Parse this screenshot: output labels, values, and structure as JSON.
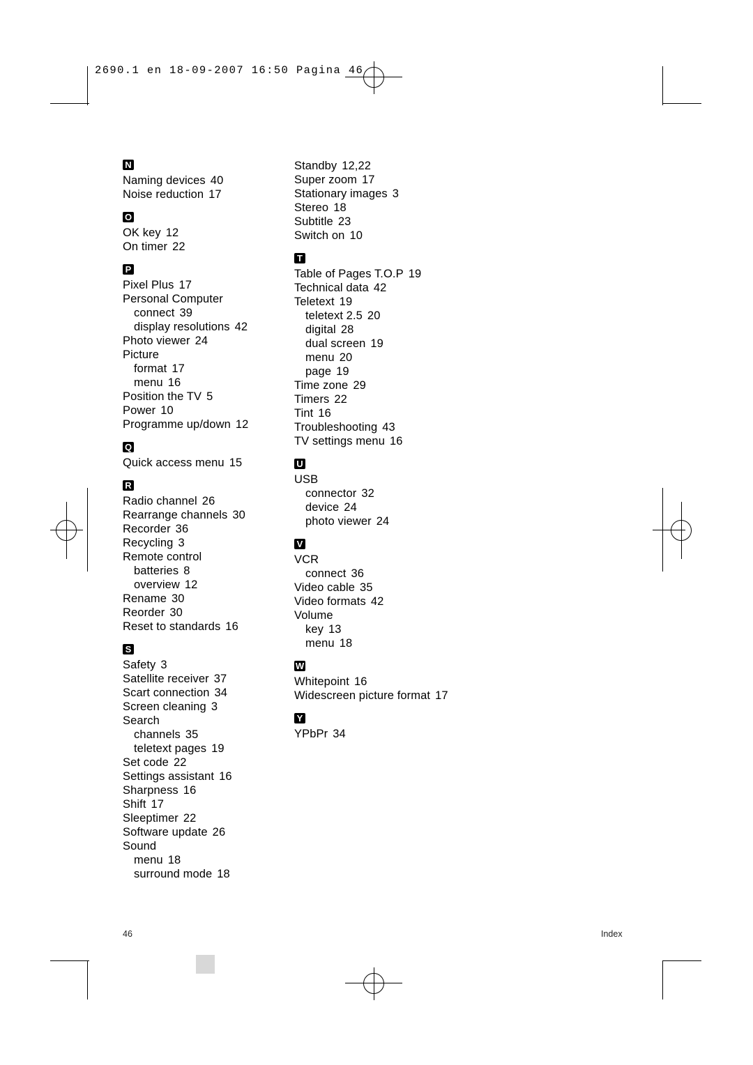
{
  "header": {
    "imprint": "2690.1 en  18-09-2007  16:50  Pagina 46"
  },
  "footer": {
    "page_number": "46",
    "section_label": "Index"
  },
  "index": {
    "left_column": [
      {
        "type": "letter",
        "label": "N"
      },
      {
        "type": "entry",
        "text": "Naming devices",
        "page": "40"
      },
      {
        "type": "entry",
        "text": "Noise reduction",
        "page": "17"
      },
      {
        "type": "letter",
        "label": "O"
      },
      {
        "type": "entry",
        "text": "OK key",
        "page": "12"
      },
      {
        "type": "entry",
        "text": "On timer",
        "page": "22"
      },
      {
        "type": "letter",
        "label": "P"
      },
      {
        "type": "entry",
        "text": "Pixel Plus",
        "page": "17"
      },
      {
        "type": "entry",
        "text": "Personal Computer",
        "page": ""
      },
      {
        "type": "sub",
        "text": "connect",
        "page": "39"
      },
      {
        "type": "sub",
        "text": "display resolutions",
        "page": "42"
      },
      {
        "type": "entry",
        "text": "Photo viewer",
        "page": "24"
      },
      {
        "type": "entry",
        "text": "Picture",
        "page": ""
      },
      {
        "type": "sub",
        "text": "format",
        "page": "17"
      },
      {
        "type": "sub",
        "text": "menu",
        "page": "16"
      },
      {
        "type": "entry",
        "text": "Position the TV",
        "page": "5"
      },
      {
        "type": "entry",
        "text": "Power",
        "page": "10"
      },
      {
        "type": "entry",
        "text": "Programme up/down",
        "page": "12"
      },
      {
        "type": "letter",
        "label": "Q"
      },
      {
        "type": "entry",
        "text": "Quick access menu",
        "page": "15"
      },
      {
        "type": "letter",
        "label": "R"
      },
      {
        "type": "entry",
        "text": "Radio channel",
        "page": "26"
      },
      {
        "type": "entry",
        "text": "Rearrange channels",
        "page": "30"
      },
      {
        "type": "entry",
        "text": "Recorder",
        "page": "36"
      },
      {
        "type": "entry",
        "text": "Recycling",
        "page": "3"
      },
      {
        "type": "entry",
        "text": "Remote control",
        "page": ""
      },
      {
        "type": "sub",
        "text": "batteries",
        "page": "8"
      },
      {
        "type": "sub",
        "text": "overview",
        "page": "12"
      },
      {
        "type": "entry",
        "text": "Rename",
        "page": "30"
      },
      {
        "type": "entry",
        "text": "Reorder",
        "page": "30"
      },
      {
        "type": "entry",
        "text": "Reset to standards",
        "page": "16"
      },
      {
        "type": "letter",
        "label": "S"
      },
      {
        "type": "entry",
        "text": "Safety",
        "page": "3"
      },
      {
        "type": "entry",
        "text": "Satellite receiver",
        "page": "37"
      },
      {
        "type": "entry",
        "text": "Scart connection",
        "page": "34"
      },
      {
        "type": "entry",
        "text": "Screen cleaning",
        "page": "3"
      },
      {
        "type": "entry",
        "text": "Search",
        "page": ""
      },
      {
        "type": "sub",
        "text": "channels",
        "page": "35"
      },
      {
        "type": "sub",
        "text": "teletext pages",
        "page": "19"
      },
      {
        "type": "entry",
        "text": "Set code",
        "page": "22"
      },
      {
        "type": "entry",
        "text": "Settings assistant",
        "page": "16"
      },
      {
        "type": "entry",
        "text": "Sharpness",
        "page": "16"
      },
      {
        "type": "entry",
        "text": "Shift",
        "page": "17"
      },
      {
        "type": "entry",
        "text": "Sleeptimer",
        "page": "22"
      },
      {
        "type": "entry",
        "text": "Software update",
        "page": "26"
      },
      {
        "type": "entry",
        "text": "Sound",
        "page": ""
      },
      {
        "type": "sub",
        "text": "menu",
        "page": "18"
      },
      {
        "type": "sub",
        "text": "surround mode",
        "page": "18"
      }
    ],
    "right_column": [
      {
        "type": "entry",
        "text": "Standby",
        "page": "12,22"
      },
      {
        "type": "entry",
        "text": "Super zoom",
        "page": "17"
      },
      {
        "type": "entry",
        "text": "Stationary images",
        "page": "3"
      },
      {
        "type": "entry",
        "text": "Stereo",
        "page": "18"
      },
      {
        "type": "entry",
        "text": "Subtitle",
        "page": "23"
      },
      {
        "type": "entry",
        "text": "Switch on",
        "page": "10"
      },
      {
        "type": "letter",
        "label": "T"
      },
      {
        "type": "entry",
        "text": "Table of Pages T.O.P",
        "page": "19"
      },
      {
        "type": "entry",
        "text": "Technical data",
        "page": "42"
      },
      {
        "type": "entry",
        "text": "Teletext",
        "page": "19"
      },
      {
        "type": "sub",
        "text": "teletext 2.5",
        "page": "20"
      },
      {
        "type": "sub",
        "text": "digital",
        "page": "28"
      },
      {
        "type": "sub",
        "text": "dual screen",
        "page": "19"
      },
      {
        "type": "sub",
        "text": "menu",
        "page": "20"
      },
      {
        "type": "sub",
        "text": "page",
        "page": "19"
      },
      {
        "type": "entry",
        "text": "Time zone",
        "page": "29"
      },
      {
        "type": "entry",
        "text": "Timers",
        "page": "22"
      },
      {
        "type": "entry",
        "text": "Tint",
        "page": "16"
      },
      {
        "type": "entry",
        "text": "Troubleshooting",
        "page": "43"
      },
      {
        "type": "entry",
        "text": "TV settings menu",
        "page": "16"
      },
      {
        "type": "letter",
        "label": "U"
      },
      {
        "type": "entry",
        "text": "USB",
        "page": ""
      },
      {
        "type": "sub",
        "text": "connector",
        "page": "32"
      },
      {
        "type": "sub",
        "text": "device",
        "page": "24"
      },
      {
        "type": "sub",
        "text": "photo viewer",
        "page": "24"
      },
      {
        "type": "letter",
        "label": "V"
      },
      {
        "type": "entry",
        "text": "VCR",
        "page": ""
      },
      {
        "type": "sub",
        "text": "connect",
        "page": "36"
      },
      {
        "type": "entry",
        "text": "Video cable",
        "page": "35"
      },
      {
        "type": "entry",
        "text": "Video formats",
        "page": "42"
      },
      {
        "type": "entry",
        "text": "Volume",
        "page": ""
      },
      {
        "type": "sub",
        "text": "key",
        "page": "13"
      },
      {
        "type": "sub",
        "text": "menu",
        "page": "18"
      },
      {
        "type": "letter",
        "label": "W"
      },
      {
        "type": "entry",
        "text": "Whitepoint",
        "page": "16"
      },
      {
        "type": "entry",
        "text": "Widescreen picture format",
        "page": "17"
      },
      {
        "type": "letter",
        "label": "Y"
      },
      {
        "type": "entry",
        "text": "YPbPr",
        "page": "34"
      }
    ]
  }
}
